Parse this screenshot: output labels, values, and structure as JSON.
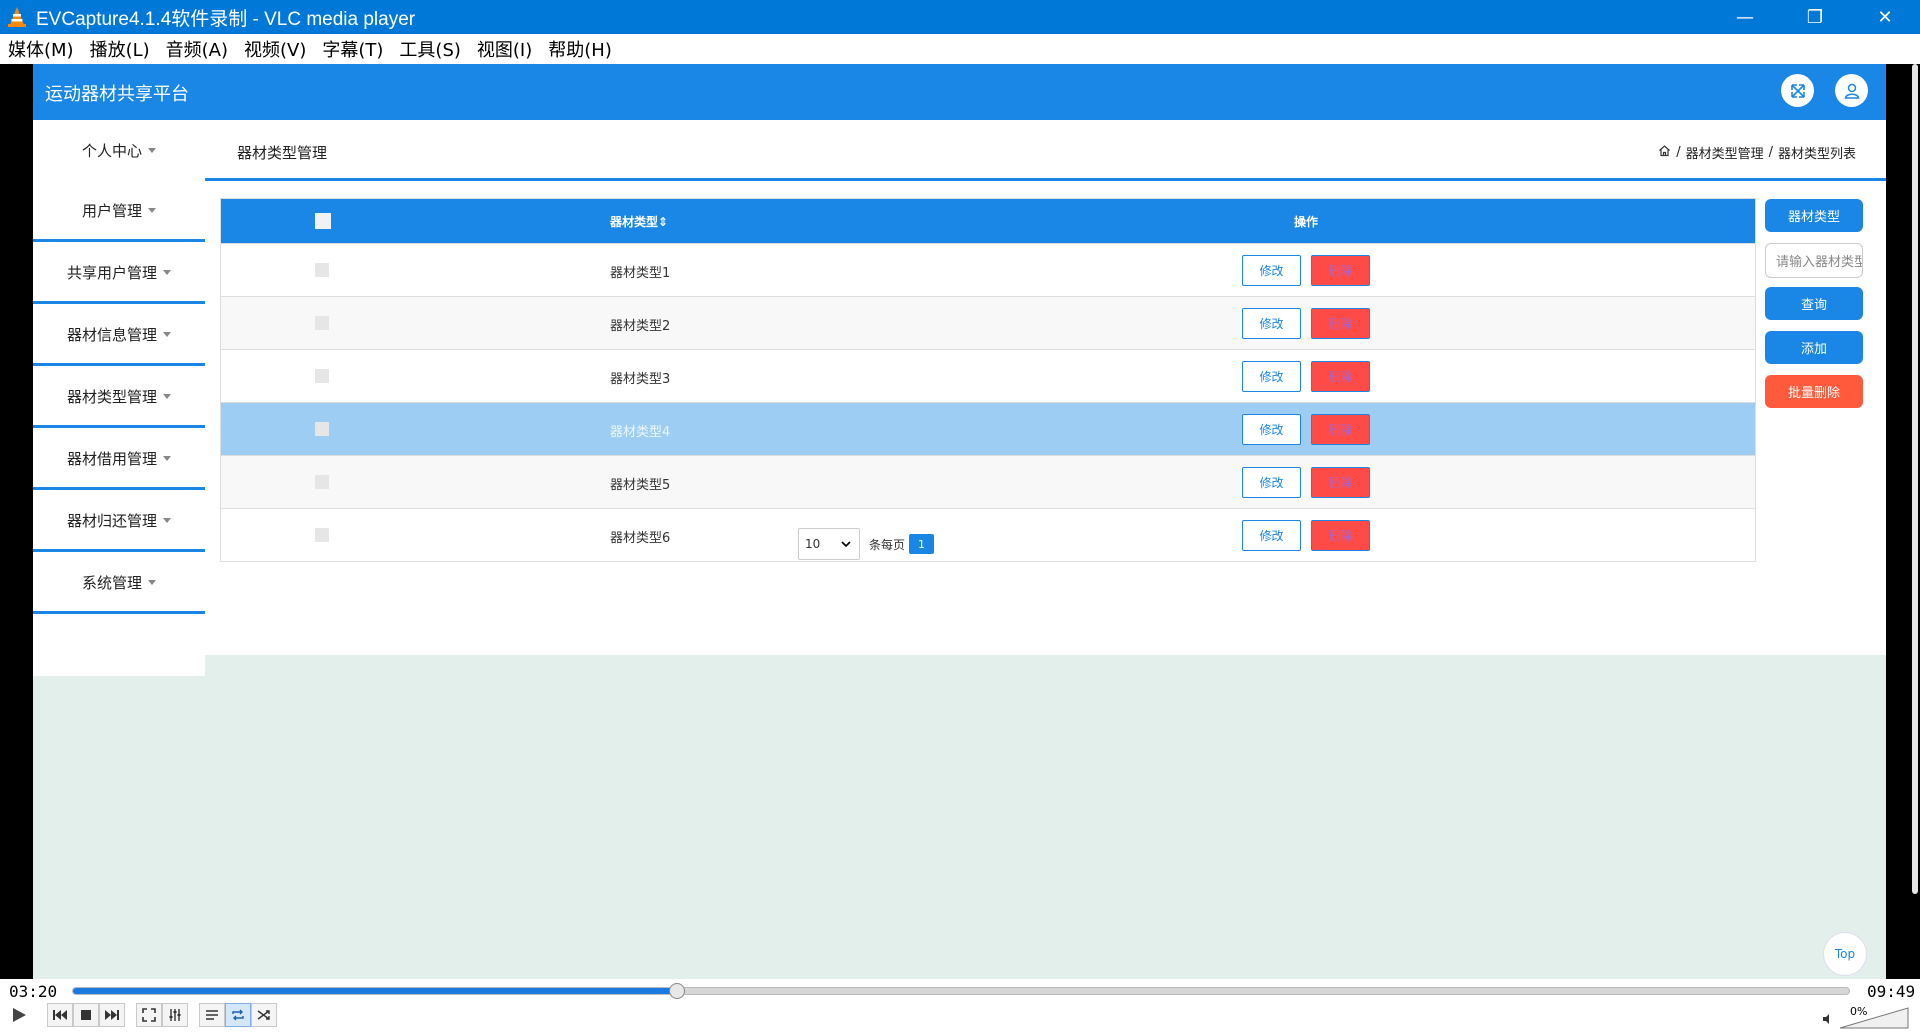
{
  "window": {
    "title": "EVCapture4.1.4软件录制 - VLC media player",
    "controls": {
      "minimize": "—",
      "restore": "❐",
      "close": "✕"
    }
  },
  "menu": [
    "媒体(M)",
    "播放(L)",
    "音频(A)",
    "视频(V)",
    "字幕(T)",
    "工具(S)",
    "视图(I)",
    "帮助(H)"
  ],
  "site": {
    "brand": "运动器材共享平台",
    "header_icons": [
      "expand-icon",
      "user-icon"
    ],
    "sidebar": [
      {
        "label": "个人中心"
      },
      {
        "label": "用户管理"
      },
      {
        "label": "共享用户管理"
      },
      {
        "label": "器材信息管理"
      },
      {
        "label": "器材类型管理"
      },
      {
        "label": "器材借用管理"
      },
      {
        "label": "器材归还管理"
      },
      {
        "label": "系统管理"
      }
    ],
    "page_title": "器材类型管理",
    "breadcrumb": {
      "home_icon": "home-icon",
      "sep": "/",
      "items": [
        "器材类型管理",
        "器材类型列表"
      ]
    },
    "table": {
      "headers": {
        "type": "器材类型",
        "sort_icon": "⇕",
        "ops": "操作"
      },
      "rows": [
        {
          "type": "器材类型1",
          "edit": "修改",
          "delete": "删除"
        },
        {
          "type": "器材类型2",
          "edit": "修改",
          "delete": "删除"
        },
        {
          "type": "器材类型3",
          "edit": "修改",
          "delete": "删除"
        },
        {
          "type": "器材类型4",
          "edit": "修改",
          "delete": "删除"
        },
        {
          "type": "器材类型5",
          "edit": "修改",
          "delete": "删除"
        },
        {
          "type": "器材类型6",
          "edit": "修改",
          "delete": "删除"
        }
      ],
      "selected_row_index": 3
    },
    "pager": {
      "page_size": "10",
      "page_size_label": "条每页",
      "current_page": "1"
    },
    "right_panel": {
      "filter_label": "器材类型",
      "search_placeholder": "请输入器材类型",
      "query": "查询",
      "add": "添加",
      "batch_delete": "批量删除"
    },
    "top_button": "Top",
    "colors": {
      "primary": "#1a86e5",
      "danger": "#ff4b47",
      "selected_row": "#9dcdf3"
    }
  },
  "player": {
    "elapsed": "03:20",
    "total": "09:49",
    "progress_fraction": 0.34,
    "volume": "0%"
  }
}
